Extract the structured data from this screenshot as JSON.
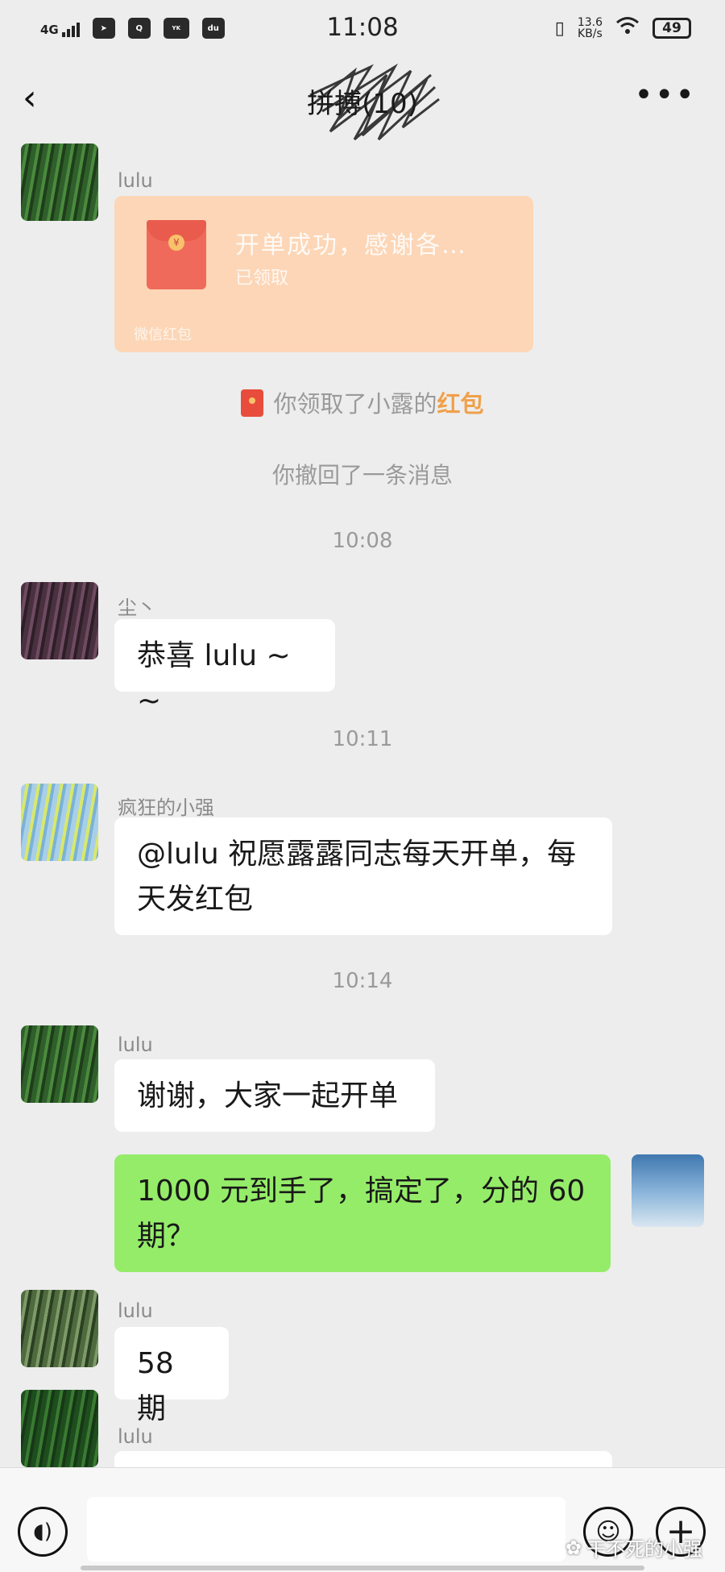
{
  "status_bar": {
    "network": "4G",
    "time": "11:08",
    "net_speed_value": "13.6",
    "net_speed_unit": "KB/s",
    "battery": "49",
    "app_icons": [
      "telegram-icon",
      "qq-icon",
      "youku-icon",
      "du-icon"
    ]
  },
  "header": {
    "title": "拼搏(10)",
    "back_icon": "chevron-left-icon",
    "more_icon": "more-dots-icon"
  },
  "messages": {
    "m1": {
      "sender": "lulu",
      "card_title": "开单成功，感谢各…",
      "card_status": "已领取",
      "card_footer": "微信红包"
    },
    "sys1": {
      "prefix": "你领取了小露的",
      "highlight": "红包"
    },
    "sys2": "你撤回了一条消息",
    "t1": "10:08",
    "m2": {
      "sender": "尘丶",
      "text": "恭喜 lulu ~ ~"
    },
    "t2": "10:11",
    "m3": {
      "sender": "疯狂的小强",
      "line1": "@lulu 祝愿露露同志每天开单，每",
      "line2": "天发红包"
    },
    "t3": "10:14",
    "m4": {
      "sender": "lulu",
      "text": "谢谢，大家一起开单"
    },
    "m5": {
      "line1": "1000 元到手了，搞定了，分的 60",
      "line2": "期？"
    },
    "m6": {
      "sender": "lulu",
      "text": "58 期"
    },
    "m7": {
      "sender": "lulu"
    }
  },
  "input_bar": {
    "voice_icon": "voice-icon",
    "emoji_icon": "emoji-icon",
    "plus_icon": "plus-icon",
    "watermark": "干不死的小强"
  },
  "colors": {
    "background": "#ededed",
    "bubble_other": "#ffffff",
    "bubble_me": "#95ec69",
    "red_packet_card": "#fcd6b6",
    "red_highlight": "#f0a04b"
  }
}
